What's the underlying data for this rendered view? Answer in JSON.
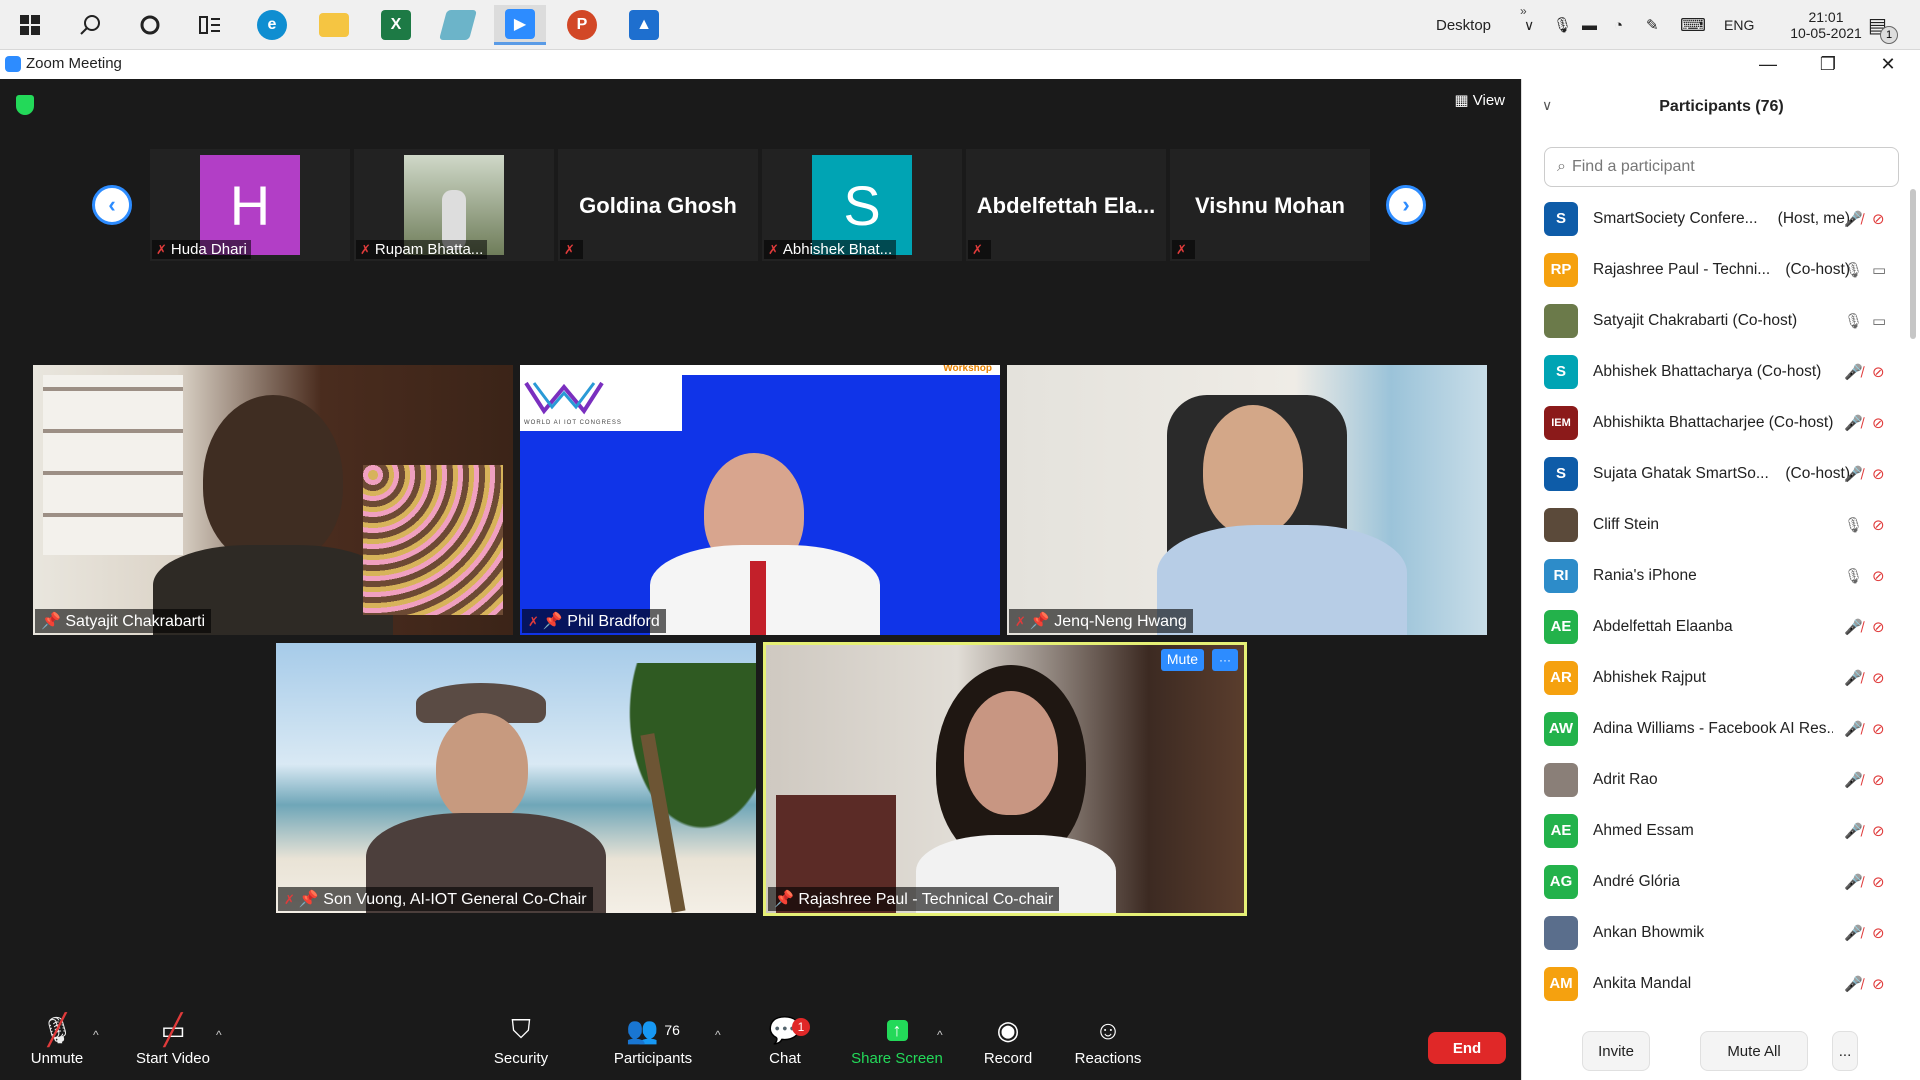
{
  "taskbar": {
    "tray_desktop": "Desktop",
    "tray_lang": "ENG",
    "clock_time": "21:01",
    "clock_date": "10-05-2021",
    "notif_count": "1"
  },
  "window": {
    "title": "Zoom Meeting",
    "view_label": "View"
  },
  "strip": [
    {
      "name": "Huda Dhari",
      "initial": "H",
      "color": "#b23ec6",
      "type": "avatar"
    },
    {
      "name": "Rupam Bhatta...",
      "type": "photo"
    },
    {
      "name": "Goldina Ghosh",
      "type": "name"
    },
    {
      "name": "Abhishek Bhat...",
      "initial": "S",
      "color": "#00a4b4",
      "type": "avatar"
    },
    {
      "name": "Abdelfettah  Ela...",
      "type": "name"
    },
    {
      "name": "Vishnu Mohan",
      "type": "name"
    }
  ],
  "videos": {
    "v1": "Satyajit Chakrabarti",
    "v2": "Phil Bradford",
    "v3": "Jenq-Neng Hwang",
    "v4": "Son Vuong, AI-IOT General Co-Chair",
    "v5": "Rajashree Paul - Technical Co-chair",
    "v2_banner": "WORLD AI IOT CONGRESS",
    "v2_workshop": "Workshop",
    "mute_label": "Mute",
    "more_label": "···"
  },
  "toolbar": {
    "unmute": "Unmute",
    "start_video": "Start Video",
    "security": "Security",
    "participants": "Participants",
    "participants_count": "76",
    "chat": "Chat",
    "chat_badge": "1",
    "share_screen": "Share Screen",
    "record": "Record",
    "reactions": "Reactions",
    "end": "End"
  },
  "panel": {
    "title": "Participants (76)",
    "search_placeholder": "Find a participant",
    "invite": "Invite",
    "mute_all": "Mute All",
    "more": "...",
    "participants": [
      {
        "initials": "S",
        "color": "#0e5ca8",
        "name": "SmartSociety Confere...",
        "role": "(Host, me)",
        "mic": "off",
        "cam": "off"
      },
      {
        "initials": "RP",
        "color": "#f5a10f",
        "name": "Rajashree Paul - Techni...",
        "role": "(Co-host)",
        "mic": "on",
        "cam": "on"
      },
      {
        "initials": "",
        "color": "#6b7a4a",
        "name": "Satyajit Chakrabarti (Co-host)",
        "role": "",
        "mic": "on",
        "cam": "on"
      },
      {
        "initials": "S",
        "color": "#00a4b4",
        "name": "Abhishek Bhattacharya (Co-host)",
        "role": "",
        "mic": "off",
        "cam": "off"
      },
      {
        "initials": "IEM",
        "color": "#8b1a1a",
        "name": "Abhishikta Bhattacharjee (Co-host)",
        "role": "",
        "mic": "off",
        "cam": "off"
      },
      {
        "initials": "S",
        "color": "#0e5ca8",
        "name": "Sujata Ghatak SmartSo...",
        "role": "(Co-host)",
        "mic": "off",
        "cam": "off"
      },
      {
        "initials": "",
        "color": "#5b4a3a",
        "name": "Cliff Stein",
        "role": "",
        "mic": "on",
        "cam": "off"
      },
      {
        "initials": "RI",
        "color": "#2d8cc9",
        "name": "Rania's iPhone",
        "role": "",
        "mic": "on",
        "cam": "off"
      },
      {
        "initials": "AE",
        "color": "#23b24b",
        "name": "Abdelfettah Elaanba",
        "role": "",
        "mic": "off",
        "cam": "off"
      },
      {
        "initials": "AR",
        "color": "#f5a10f",
        "name": "Abhishek Rajput",
        "role": "",
        "mic": "off",
        "cam": "off"
      },
      {
        "initials": "AW",
        "color": "#23b24b",
        "name": "Adina Williams - Facebook AI Res...",
        "role": "",
        "mic": "off",
        "cam": "off"
      },
      {
        "initials": "",
        "color": "#8a7f78",
        "name": "Adrit Rao",
        "role": "",
        "mic": "off",
        "cam": "off"
      },
      {
        "initials": "AE",
        "color": "#23b24b",
        "name": "Ahmed Essam",
        "role": "",
        "mic": "off",
        "cam": "off"
      },
      {
        "initials": "AG",
        "color": "#23b24b",
        "name": "André Glória",
        "role": "",
        "mic": "off",
        "cam": "off"
      },
      {
        "initials": "",
        "color": "#5a6e8c",
        "name": "Ankan Bhowmik",
        "role": "",
        "mic": "off",
        "cam": "off"
      },
      {
        "initials": "AM",
        "color": "#f5a10f",
        "name": "Ankita Mandal",
        "role": "",
        "mic": "off",
        "cam": "off"
      }
    ]
  }
}
